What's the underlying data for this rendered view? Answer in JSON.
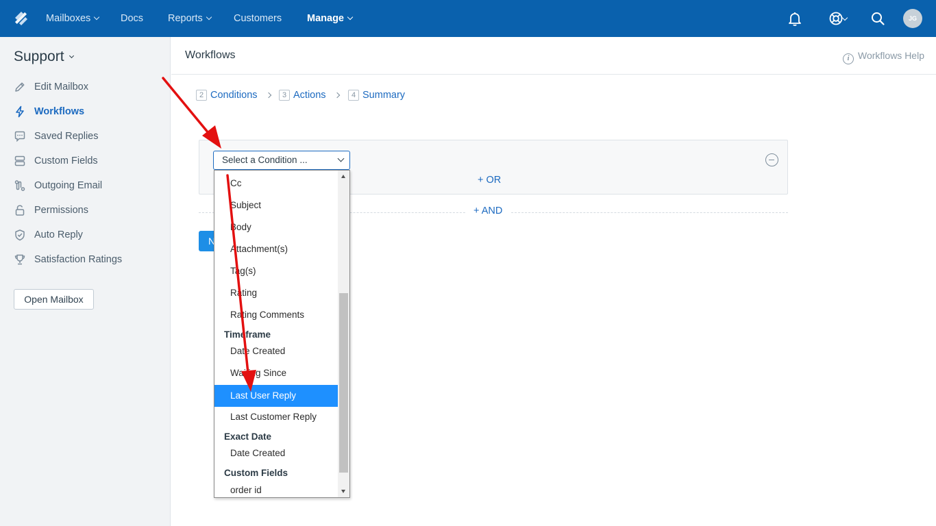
{
  "topbar": {
    "nav": [
      {
        "label": "Mailboxes",
        "has_caret": true
      },
      {
        "label": "Docs",
        "has_caret": false
      },
      {
        "label": "Reports",
        "has_caret": true
      },
      {
        "label": "Customers",
        "has_caret": false
      },
      {
        "label": "Manage",
        "has_caret": true,
        "active": true
      }
    ],
    "icons": [
      "bell-icon",
      "lifebuoy-icon",
      "search-icon"
    ],
    "avatar_initials": "JG",
    "bar_color": "#0a61ad"
  },
  "sidebar": {
    "title": "Support",
    "items": [
      {
        "label": "Edit Mailbox",
        "icon": "pencil-icon"
      },
      {
        "label": "Workflows",
        "icon": "bolt-icon",
        "active": true
      },
      {
        "label": "Saved Replies",
        "icon": "chat-bubble-icon"
      },
      {
        "label": "Custom Fields",
        "icon": "fields-icon"
      },
      {
        "label": "Outgoing Email",
        "icon": "route-icon"
      },
      {
        "label": "Permissions",
        "icon": "lock-icon"
      },
      {
        "label": "Auto Reply",
        "icon": "shield-check-icon"
      },
      {
        "label": "Satisfaction Ratings",
        "icon": "trophy-icon"
      }
    ],
    "open_mailbox_label": "Open Mailbox"
  },
  "main": {
    "title": "Workflows",
    "help_label": "Workflows Help",
    "steps": [
      {
        "num": "2",
        "label": "Conditions"
      },
      {
        "num": "3",
        "label": "Actions"
      },
      {
        "num": "4",
        "label": "Summary"
      }
    ],
    "condition_select_value": "Select a Condition ...",
    "or_label": "+ OR",
    "and_label": "+ AND",
    "next_button_label": "N"
  },
  "dropdown": {
    "options": [
      {
        "label": "Cc",
        "type": "option"
      },
      {
        "label": "Subject",
        "type": "option"
      },
      {
        "label": "Body",
        "type": "option"
      },
      {
        "label": "Attachment(s)",
        "type": "option"
      },
      {
        "label": "Tag(s)",
        "type": "option"
      },
      {
        "label": "Rating",
        "type": "option"
      },
      {
        "label": "Rating Comments",
        "type": "option"
      },
      {
        "label": "Timeframe",
        "type": "group"
      },
      {
        "label": "Date Created",
        "type": "option"
      },
      {
        "label": "Waiting Since",
        "type": "option"
      },
      {
        "label": "Last User Reply",
        "type": "option",
        "selected": true
      },
      {
        "label": "Last Customer Reply",
        "type": "option"
      },
      {
        "label": "Exact Date",
        "type": "group"
      },
      {
        "label": "Date Created",
        "type": "option"
      },
      {
        "label": "Custom Fields",
        "type": "group"
      },
      {
        "label": "order id",
        "type": "option"
      }
    ],
    "highlight_color": "#1e90ff"
  },
  "annotations": {
    "arrow_color": "#e31010"
  }
}
